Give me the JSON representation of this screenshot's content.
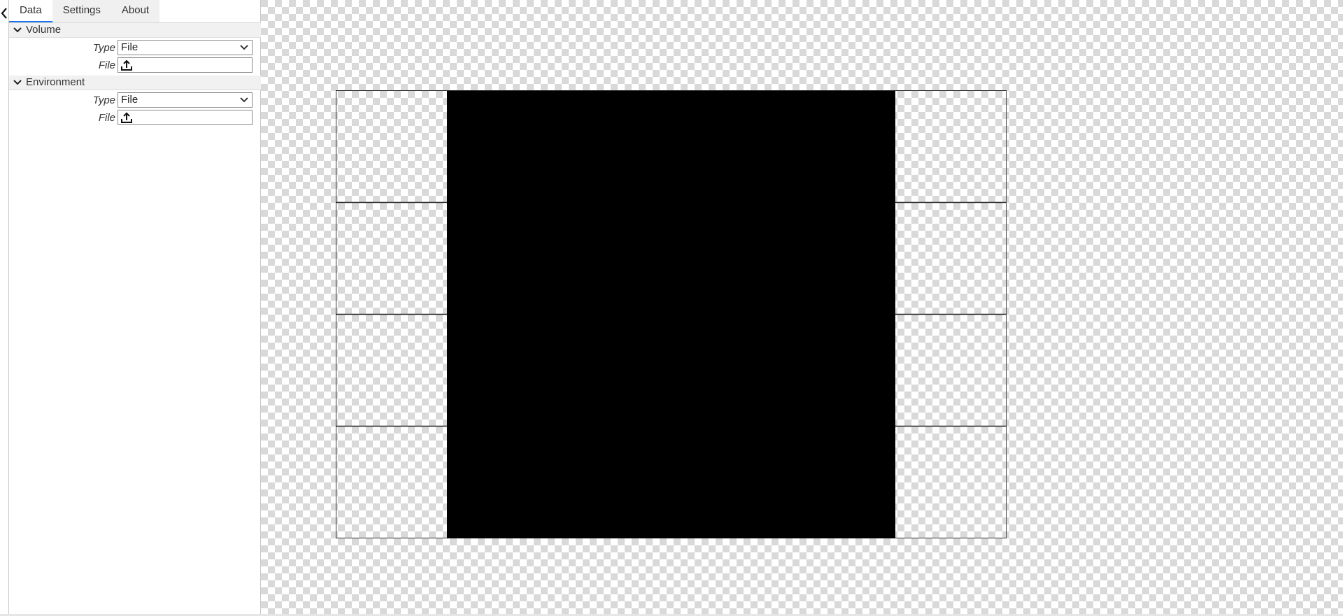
{
  "tabs": [
    {
      "label": "Data",
      "active": true
    },
    {
      "label": "Settings",
      "active": false
    },
    {
      "label": "About",
      "active": false
    }
  ],
  "sections": [
    {
      "title": "Volume",
      "type_label": "Type",
      "type_value": "File",
      "file_label": "File"
    },
    {
      "title": "Environment",
      "type_label": "Type",
      "type_value": "File",
      "file_label": "File"
    }
  ],
  "icons": {
    "collapse": "chevron-left-icon",
    "section_toggle": "chevron-down-icon",
    "dropdown": "chevron-down-icon",
    "upload": "upload-icon"
  },
  "colors": {
    "accent": "#1a73e8",
    "render_fill": "#000000",
    "checker_dark": "#d9d9d9",
    "checker_light": "#ffffff"
  }
}
